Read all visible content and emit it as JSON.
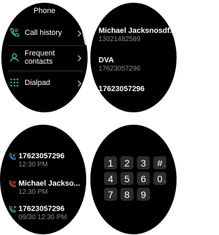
{
  "watch1": {
    "title": "Phone",
    "items": [
      {
        "label": "Call history",
        "icon": "call-history-icon"
      },
      {
        "label": "Frequent contacts",
        "icon": "contact-icon"
      },
      {
        "label": "Dialpad",
        "icon": "dialpad-icon"
      }
    ],
    "colors": {
      "accent": "#3dbd6a"
    }
  },
  "watch2": {
    "contacts": [
      {
        "name": "Michael Jacksnosdf...",
        "number": "13021482589"
      },
      {
        "name": "DVA",
        "number": "17623057296"
      },
      {
        "name": "17623057296",
        "number": ""
      }
    ]
  },
  "watch3": {
    "calls": [
      {
        "title": "17623057296",
        "time": "12:30 PM",
        "icon": "incoming-call-icon",
        "color": "#3a8ee6"
      },
      {
        "title": "Michael Jackso...",
        "time": "12:30 PM",
        "icon": "missed-call-icon",
        "color": "#e8453c"
      },
      {
        "title": "17623057296",
        "time": "09/30 12:30 PM",
        "icon": "outgoing-call-icon",
        "color": "#3dbd6a"
      }
    ]
  },
  "watch4": {
    "keys": [
      {
        "digit": "1",
        "sub": ""
      },
      {
        "digit": "2",
        "sub": ""
      },
      {
        "digit": "3",
        "sub": ""
      },
      {
        "digit": "#",
        "sub": "+"
      },
      {
        "digit": "4",
        "sub": ""
      },
      {
        "digit": "5",
        "sub": ""
      },
      {
        "digit": "6",
        "sub": ""
      },
      {
        "digit": "0",
        "sub": "+"
      },
      {
        "digit": "7",
        "sub": ""
      },
      {
        "digit": "8",
        "sub": ""
      },
      {
        "digit": "9",
        "sub": ""
      }
    ]
  }
}
